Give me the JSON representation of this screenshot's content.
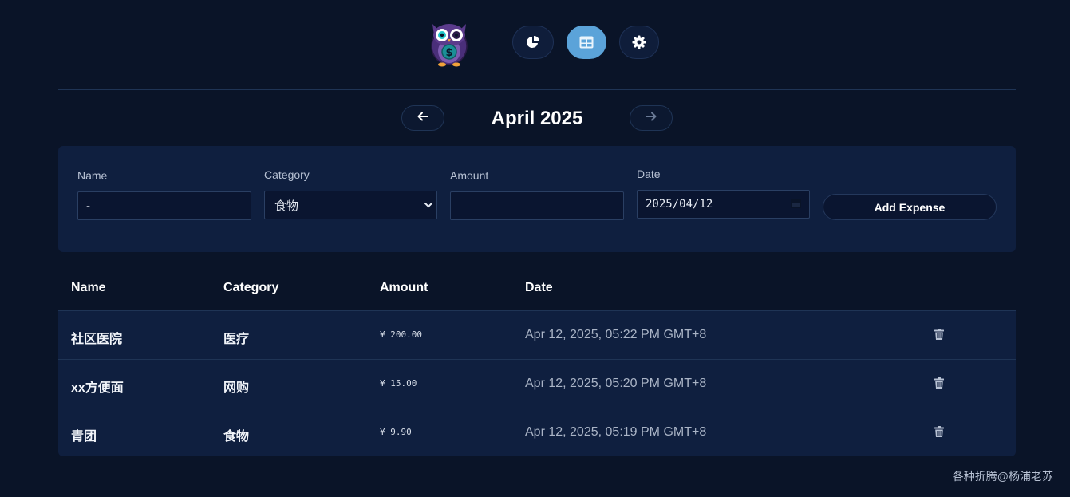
{
  "header": {
    "logo": "owl-dollar-logo",
    "nav": [
      {
        "icon": "pie-chart-icon",
        "active": false
      },
      {
        "icon": "table-icon",
        "active": true
      },
      {
        "icon": "gear-icon",
        "active": false
      }
    ]
  },
  "month_nav": {
    "title": "April 2025",
    "prev_icon": "arrow-left-icon",
    "next_icon": "arrow-right-icon"
  },
  "form": {
    "name_label": "Name",
    "name_value": "-",
    "category_label": "Category",
    "category_value": "食物",
    "amount_label": "Amount",
    "amount_value": "",
    "date_label": "Date",
    "date_value": "2025/04/12",
    "add_button": "Add Expense"
  },
  "table": {
    "headers": {
      "name": "Name",
      "category": "Category",
      "amount": "Amount",
      "date": "Date"
    },
    "rows": [
      {
        "name": "社区医院",
        "category": "医疗",
        "amount": "¥ 200.00",
        "date": "Apr 12, 2025, 05:22 PM GMT+8"
      },
      {
        "name": "xx方便面",
        "category": "网购",
        "amount": "¥ 15.00",
        "date": "Apr 12, 2025, 05:20 PM GMT+8"
      },
      {
        "name": "青团",
        "category": "食物",
        "amount": "¥ 9.90",
        "date": "Apr 12, 2025, 05:19 PM GMT+8"
      }
    ]
  },
  "footer": {
    "watermark": "各种折腾@杨浦老苏"
  },
  "colors": {
    "background": "#0a1428",
    "card": "#0f1f3f",
    "accent": "#5ba3d9"
  }
}
